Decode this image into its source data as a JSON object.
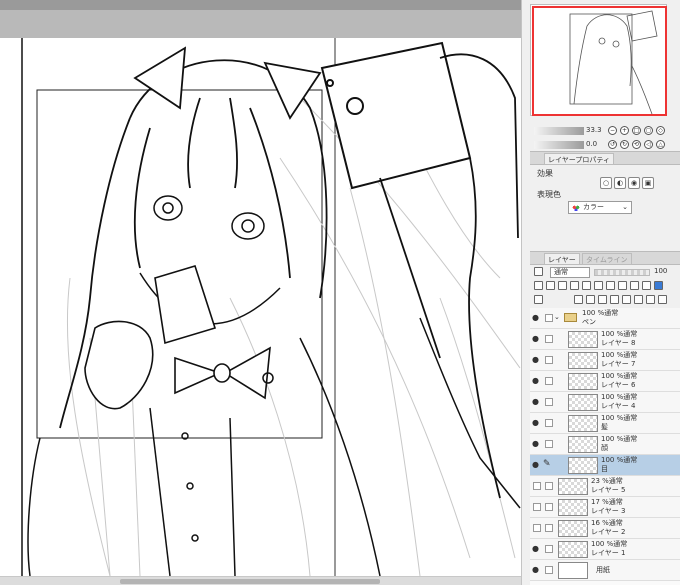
{
  "navigator": {
    "zoom_value": "33.3",
    "rotation_value": "0.0"
  },
  "layer_property_panel": {
    "tab_label": "レイヤープロパティ",
    "effect_label": "効果",
    "expression_color_label": "表現色",
    "expression_color_value": "カラー"
  },
  "layer_panel": {
    "tab_label": "レイヤー",
    "tab2_label": "タイムライン",
    "blend_mode": "通常",
    "opacity": "100",
    "layers": [
      {
        "mode": "100 %通常",
        "name": "ペン",
        "type": "folder",
        "visible": true
      },
      {
        "mode": "100 %通常",
        "name": "レイヤー 8",
        "type": "raster",
        "visible": true
      },
      {
        "mode": "100 %通常",
        "name": "レイヤー 7",
        "type": "raster",
        "visible": true
      },
      {
        "mode": "100 %通常",
        "name": "レイヤー 6",
        "type": "raster",
        "visible": true
      },
      {
        "mode": "100 %通常",
        "name": "レイヤー 4",
        "type": "raster",
        "visible": true
      },
      {
        "mode": "100 %通常",
        "name": "髪",
        "type": "raster",
        "visible": true
      },
      {
        "mode": "100 %通常",
        "name": "顔",
        "type": "raster",
        "visible": true
      },
      {
        "mode": "100 %通常",
        "name": "目",
        "type": "raster",
        "visible": true,
        "selected": true
      },
      {
        "mode": "23 %通常",
        "name": "レイヤー 5",
        "type": "raster",
        "visible": false
      },
      {
        "mode": "17 %通常",
        "name": "レイヤー 3",
        "type": "raster",
        "visible": false
      },
      {
        "mode": "16 %通常",
        "name": "レイヤー 2",
        "type": "raster",
        "visible": false
      },
      {
        "mode": "100 %通常",
        "name": "レイヤー 1",
        "type": "raster",
        "visible": true
      },
      {
        "mode": "",
        "name": "用紙",
        "type": "paper",
        "visible": true
      }
    ]
  },
  "colors": {
    "navigator_frame": "#e33333",
    "selected_layer": "#b7cfe6",
    "canvas_bg": "#ffffff"
  }
}
